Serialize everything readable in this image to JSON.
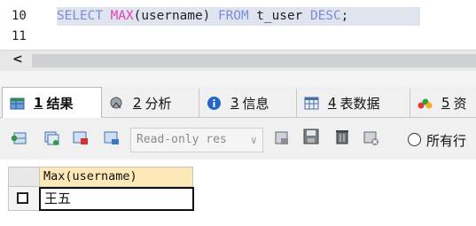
{
  "editor": {
    "line_numbers": [
      "10",
      "11"
    ],
    "sql": {
      "kw1": "SELECT",
      "fn": "MAX",
      "arg": "(username)",
      "kw2": "FROM",
      "table": "t_user",
      "kw3": "DESC",
      "end": ";"
    },
    "scroll_left": "<"
  },
  "tabs": [
    {
      "num": "1",
      "label": "结果",
      "icon": "grid-result-icon"
    },
    {
      "num": "2",
      "label": "分析",
      "icon": "profile-icon"
    },
    {
      "num": "3",
      "label": "信息",
      "icon": "info-icon"
    },
    {
      "num": "4",
      "label": "表数据",
      "icon": "table-data-icon"
    },
    {
      "num": "5",
      "label": "资",
      "icon": "chart-icon"
    }
  ],
  "toolbar": {
    "mode_select": "Read-only res",
    "radio_label": "所有行"
  },
  "result": {
    "column_header": "Max(username)",
    "rows": [
      "王五"
    ]
  },
  "colors": {
    "keyword": "#7b8dd8",
    "function": "#e040b8",
    "selection": "#dfe4ee",
    "header_bg": "#fde8b8"
  }
}
